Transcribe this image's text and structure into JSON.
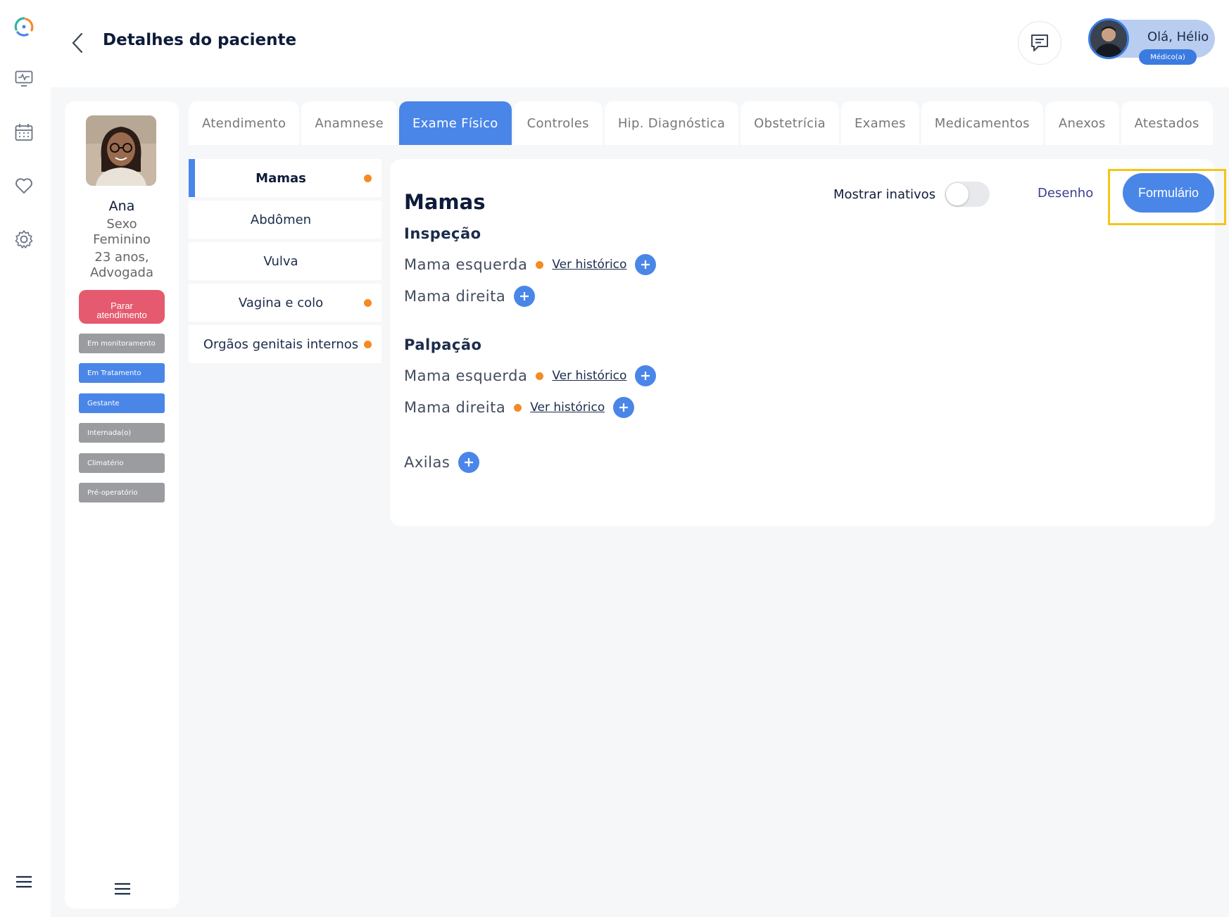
{
  "header": {
    "title": "Detalhes do paciente",
    "user_greeting": "Olá, Hélio",
    "user_role": "Médico(a)"
  },
  "rail": {
    "icons": [
      "logo-icon",
      "monitor-icon",
      "calendar-icon",
      "heart-icon",
      "settings-icon",
      "menu-icon"
    ]
  },
  "patient": {
    "name": "Ana",
    "sex_label": "Sexo",
    "sex_value": "Feminino",
    "age": "23 anos,",
    "occupation": "Advogada",
    "stop_button_line1": "Parar",
    "stop_button_line2": "atendimento",
    "tags": [
      {
        "label": "Em monitoramento",
        "color": "#9a9ca0"
      },
      {
        "label": "Em Tratamento",
        "color": "#4a86e8"
      },
      {
        "label": "Gestante",
        "color": "#4a86e8"
      },
      {
        "label": "Internada(o)",
        "color": "#9a9ca0"
      },
      {
        "label": "Climatério",
        "color": "#9a9ca0"
      },
      {
        "label": "Pré-operatório",
        "color": "#9a9ca0"
      }
    ]
  },
  "tabs": [
    {
      "label": "Atendimento",
      "active": false
    },
    {
      "label": "Anamnese",
      "active": false
    },
    {
      "label": "Exame Físico",
      "active": true
    },
    {
      "label": "Controles",
      "active": false
    },
    {
      "label": "Hip. Diagnóstica",
      "active": false
    },
    {
      "label": "Obstetrícia",
      "active": false
    },
    {
      "label": "Exames",
      "active": false
    },
    {
      "label": "Medicamentos",
      "active": false
    },
    {
      "label": "Anexos",
      "active": false
    },
    {
      "label": "Atestados",
      "active": false
    }
  ],
  "sections": [
    {
      "label": "Mamas",
      "active": true,
      "dot": true
    },
    {
      "label": "Abdômen",
      "active": false,
      "dot": false
    },
    {
      "label": "Vulva",
      "active": false,
      "dot": false
    },
    {
      "label": "Vagina e colo",
      "active": false,
      "dot": true
    },
    {
      "label": "Orgãos genitais internos",
      "active": false,
      "dot": true
    }
  ],
  "panel": {
    "title": "Mamas",
    "show_inactive_label": "Mostrar inativos",
    "show_inactive_on": false,
    "drawing_link": "Desenho",
    "form_button": "Formulário",
    "history_link": "Ver histórico",
    "groups": {
      "inspecao": {
        "title": "Inspeção",
        "left": "Mama esquerda",
        "right": "Mama direita"
      },
      "palpacao": {
        "title": "Palpação",
        "left": "Mama esquerda",
        "right": "Mama direita"
      },
      "axilas": {
        "label": "Axilas"
      }
    }
  },
  "colors": {
    "accent": "#4a86e8",
    "dot": "#f58a25",
    "stop": "#e55a6e",
    "highlight": "#f5c518"
  }
}
